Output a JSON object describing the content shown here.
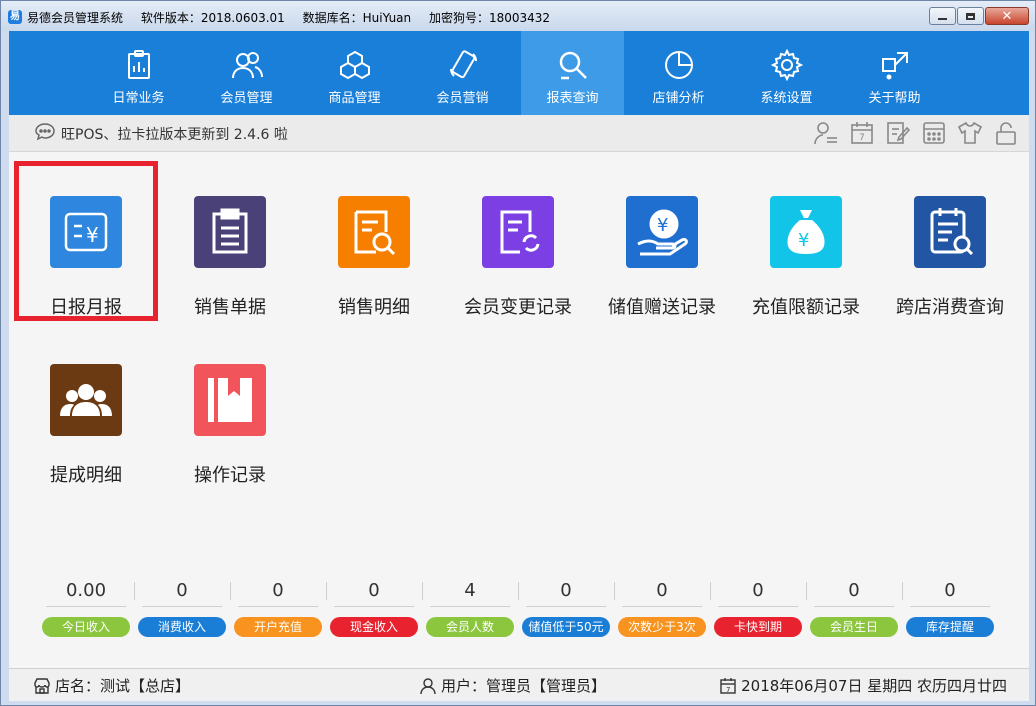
{
  "window": {
    "app_icon": "易",
    "title": "易德会员管理系统",
    "version": "软件版本：2018.0603.01",
    "database": "数据库名：HuiYuan",
    "dongle": "加密狗号：18003432"
  },
  "nav": [
    {
      "label": "日常业务",
      "icon": "clipboard-icon"
    },
    {
      "label": "会员管理",
      "icon": "users-icon"
    },
    {
      "label": "商品管理",
      "icon": "boxes-icon"
    },
    {
      "label": "会员营销",
      "icon": "phone-icon"
    },
    {
      "label": "报表查询",
      "icon": "search-icon",
      "active": true
    },
    {
      "label": "店铺分析",
      "icon": "pie-chart-icon"
    },
    {
      "label": "系统设置",
      "icon": "gear-icon"
    },
    {
      "label": "关于帮助",
      "icon": "help-icon"
    }
  ],
  "notice": "旺POS、拉卡拉版本更新到 2.4.6 啦",
  "toolbar_icons": [
    "user-switch-icon",
    "calendar-icon",
    "edit-icon",
    "calculator-icon",
    "shirt-icon",
    "lock-icon"
  ],
  "reports": [
    {
      "label": "日报月报",
      "color": "#2e86de",
      "icon": "daily-report-icon"
    },
    {
      "label": "销售单据",
      "color": "#4a4178",
      "icon": "sales-receipt-icon"
    },
    {
      "label": "销售明细",
      "color": "#f77f00",
      "icon": "sales-detail-icon"
    },
    {
      "label": "会员变更记录",
      "color": "#7b3fe4",
      "icon": "member-change-icon"
    },
    {
      "label": "储值赠送记录",
      "color": "#1f6fd1",
      "icon": "stored-gift-icon"
    },
    {
      "label": "充值限额记录",
      "color": "#12c5e8",
      "icon": "money-bag-icon"
    },
    {
      "label": "跨店消费查询",
      "color": "#2255a4",
      "icon": "cross-store-icon"
    },
    {
      "label": "提成明细",
      "color": "#6b3a12",
      "icon": "commission-icon"
    },
    {
      "label": "操作记录",
      "color": "#f2545b",
      "icon": "operation-log-icon"
    }
  ],
  "stats": [
    {
      "value": "0.00",
      "label": "今日收入",
      "color": "#8cc63f"
    },
    {
      "value": "0",
      "label": "消费收入",
      "color": "#1b7ed6"
    },
    {
      "value": "0",
      "label": "开户充值",
      "color": "#f7931e"
    },
    {
      "value": "0",
      "label": "现金收入",
      "color": "#e8232f"
    },
    {
      "value": "4",
      "label": "会员人数",
      "color": "#8cc63f"
    },
    {
      "value": "0",
      "label": "储值低于50元",
      "color": "#1b7ed6"
    },
    {
      "value": "0",
      "label": "次数少于3次",
      "color": "#f7931e"
    },
    {
      "value": "0",
      "label": "卡快到期",
      "color": "#e8232f"
    },
    {
      "value": "0",
      "label": "会员生日",
      "color": "#8cc63f"
    },
    {
      "value": "0",
      "label": "库存提醒",
      "color": "#1b7ed6"
    }
  ],
  "status": {
    "store": "店名：测试【总店】",
    "user": "用户：管理员【管理员】",
    "date": "2018年06月07日 星期四 农历四月廿四"
  }
}
